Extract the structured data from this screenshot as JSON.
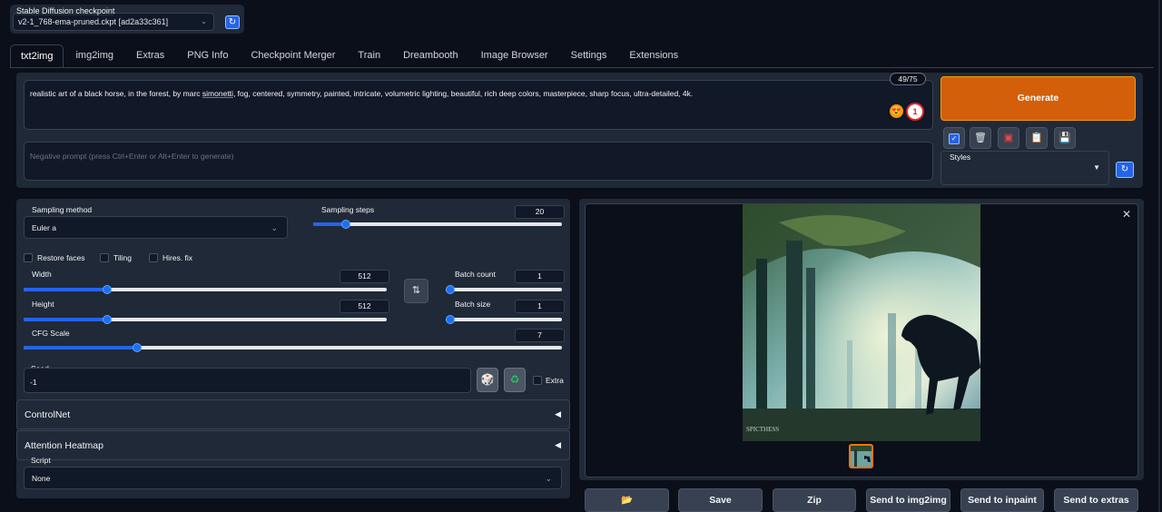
{
  "checkpoint": {
    "label": "Stable Diffusion checkpoint",
    "value": "v2-1_768-ema-pruned.ckpt [ad2a33c361]",
    "refresh_icon": "refresh-icon"
  },
  "tabs": [
    "txt2img",
    "img2img",
    "Extras",
    "PNG Info",
    "Checkpoint Merger",
    "Train",
    "Dreambooth",
    "Image Browser",
    "Settings",
    "Extensions"
  ],
  "active_tab": "txt2img",
  "prompt": {
    "text_before": "realistic art of a black horse, in the forest, by marc ",
    "underlined": "simonetti",
    "text_after": ", fog, centered, symmetry, painted, intricate, volumetric lighting, beautiful, rich deep colors, masterpiece, sharp focus, ultra-detailed, 4k.",
    "token_counter": "49/75",
    "negative_placeholder": "Negative prompt (press Ctrl+Enter or Alt+Enter to generate)"
  },
  "generate_label": "Generate",
  "tools": [
    "checkbox-icon",
    "trash-icon",
    "red-card-icon",
    "clipboard-icon",
    "save-icon"
  ],
  "styles": {
    "label": "Styles",
    "value": ""
  },
  "sampling": {
    "method_label": "Sampling method",
    "method_value": "Euler a",
    "steps_label": "Sampling steps",
    "steps_value": "20",
    "steps_fraction": 0.13
  },
  "checkboxes": {
    "restore_faces": "Restore faces",
    "tiling": "Tiling",
    "hires_fix": "Hires. fix"
  },
  "width": {
    "label": "Width",
    "value": "512",
    "fraction": 0.23
  },
  "height": {
    "label": "Height",
    "value": "512",
    "fraction": 0.23
  },
  "batch_count": {
    "label": "Batch count",
    "value": "1",
    "fraction": 0.0
  },
  "batch_size": {
    "label": "Batch size",
    "value": "1",
    "fraction": 0.0
  },
  "cfg": {
    "label": "CFG Scale",
    "value": "7",
    "fraction": 0.21
  },
  "seed": {
    "label": "Seed",
    "value": "-1",
    "extra_label": "Extra"
  },
  "accordions": {
    "controlnet": "ControlNet",
    "attention": "Attention Heatmap"
  },
  "script": {
    "label": "Script",
    "value": "None"
  },
  "actions": [
    "Save",
    "Zip",
    "Send to img2img",
    "Send to inpaint",
    "Send to extras"
  ],
  "colors": {
    "accent": "#d35f0a",
    "primary": "#2563eb",
    "background": "#0b0f19",
    "panel": "#1f2937"
  }
}
